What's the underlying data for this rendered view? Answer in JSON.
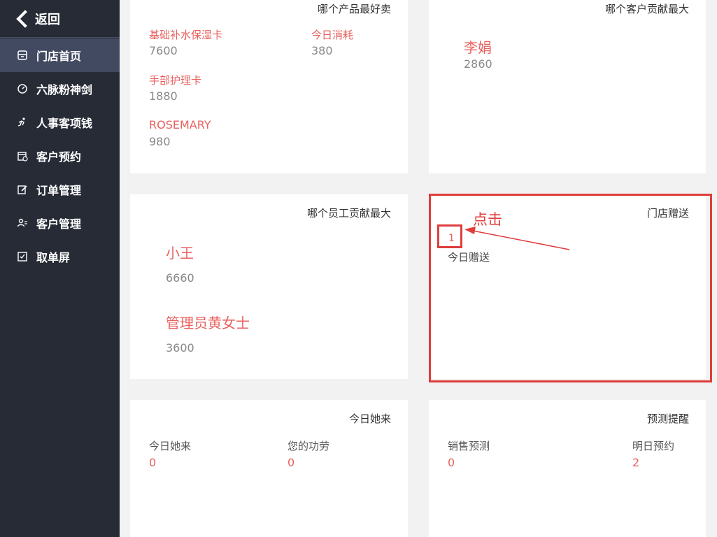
{
  "sidebar": {
    "back_label": "返回",
    "items": [
      {
        "label": "门店首页",
        "icon": "store-icon",
        "active": true
      },
      {
        "label": "六脉粉神剑",
        "icon": "gauge-icon",
        "active": false
      },
      {
        "label": "人事客项钱",
        "icon": "runner-icon",
        "active": false
      },
      {
        "label": "客户预约",
        "icon": "calendar-icon",
        "active": false
      },
      {
        "label": "订单管理",
        "icon": "edit-icon",
        "active": false
      },
      {
        "label": "客户管理",
        "icon": "users-icon",
        "active": false
      },
      {
        "label": "取单屏",
        "icon": "checkbox-icon",
        "active": false
      }
    ]
  },
  "products": {
    "title": "哪个产品最好卖",
    "items": [
      {
        "name": "基础补水保湿卡",
        "value": "7600"
      },
      {
        "name": "今日消耗",
        "value": "380"
      },
      {
        "name": "手部护理卡",
        "value": "1880"
      },
      {
        "name": "ROSEMARY",
        "value": "980"
      }
    ]
  },
  "customers": {
    "title": "哪个客户贡献最大",
    "name": "李娟",
    "value": "2860"
  },
  "staff": {
    "title": "哪个员工贡献最大",
    "items": [
      {
        "name": "小王",
        "value": "6660"
      },
      {
        "name": "管理员黄女士",
        "value": "3600"
      }
    ]
  },
  "gift": {
    "title": "门店赠送",
    "count": "1",
    "label": "今日赠送"
  },
  "visits": {
    "title": "今日她来",
    "items": [
      {
        "label": "今日她来",
        "value": "0"
      },
      {
        "label": "您的功劳",
        "value": "0"
      }
    ]
  },
  "forecast": {
    "title": "预测提醒",
    "items": [
      {
        "label": "销售预测",
        "value": "0"
      },
      {
        "label": "明日预约",
        "value": "2"
      }
    ]
  },
  "annotation": {
    "text": "点击",
    "color": "#e03c3c"
  },
  "colors": {
    "sidebar_bg": "#262b36",
    "sidebar_active": "#424a62",
    "accent_red": "#e8615f"
  }
}
